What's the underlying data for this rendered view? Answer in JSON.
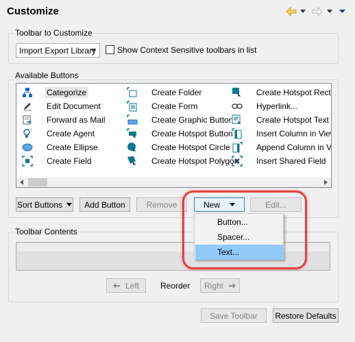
{
  "header": {
    "title": "Customize",
    "nav_icons": [
      "back-arrow-icon",
      "dropdown-icon",
      "forward-arrow-icon",
      "dropdown-icon",
      "menu-icon"
    ]
  },
  "toolbar_group": {
    "label": "Toolbar to Customize",
    "selected_toolbar": "Import Export Library",
    "checkbox_label": "Show Context Sensitive toolbars in list",
    "checkbox_checked": false
  },
  "available_group": {
    "label": "Available Buttons",
    "columns": [
      [
        {
          "label": "Categorize",
          "icon": "categorize-icon",
          "selected": true
        },
        {
          "label": "Edit Document",
          "icon": "edit-document-icon"
        },
        {
          "label": "Forward as Mail",
          "icon": "forward-mail-icon"
        },
        {
          "label": "Create Agent",
          "icon": "agent-icon"
        },
        {
          "label": "Create Ellipse",
          "icon": "ellipse-icon"
        },
        {
          "label": "Create Field",
          "icon": "field-icon"
        }
      ],
      [
        {
          "label": "Create Folder",
          "icon": "folder-icon"
        },
        {
          "label": "Create Form",
          "icon": "form-icon"
        },
        {
          "label": "Create Graphic Button",
          "icon": "graphic-button-icon"
        },
        {
          "label": "Create Hotspot Button",
          "icon": "hotspot-button-icon"
        },
        {
          "label": "Create Hotspot Circle",
          "icon": "hotspot-circle-icon"
        },
        {
          "label": "Create Hotspot Polygon",
          "icon": "hotspot-polygon-icon"
        }
      ],
      [
        {
          "label": "Create Hotspot Rectang",
          "icon": "hotspot-rectangle-icon"
        },
        {
          "label": "Hyperlink...",
          "icon": "hyperlink-icon"
        },
        {
          "label": "Create Hotspot Text Po",
          "icon": "hotspot-text-icon"
        },
        {
          "label": "Insert Column in View",
          "icon": "insert-column-icon"
        },
        {
          "label": "Append Column in View",
          "icon": "append-column-icon"
        },
        {
          "label": "Insert Shared Field",
          "icon": "shared-field-icon"
        }
      ]
    ],
    "buttons": {
      "sort": "Sort Buttons",
      "add": "Add Button",
      "remove": "Remove",
      "new": "New",
      "edit": "Edit..."
    }
  },
  "new_menu": {
    "items": [
      "Button...",
      "Spacer...",
      "Text..."
    ],
    "active_index": 2
  },
  "contents_group": {
    "label": "Toolbar Contents",
    "left": "Left",
    "reorder": "Reorder",
    "right": "Right"
  },
  "footer": {
    "save": "Save Toolbar",
    "restore": "Restore Defaults"
  },
  "colors": {
    "highlight_ring": "#e0403e",
    "menu_active": "#91c9f7",
    "accent_blue": "#1f6fb5",
    "icon_teal": "#0a7a8c"
  }
}
